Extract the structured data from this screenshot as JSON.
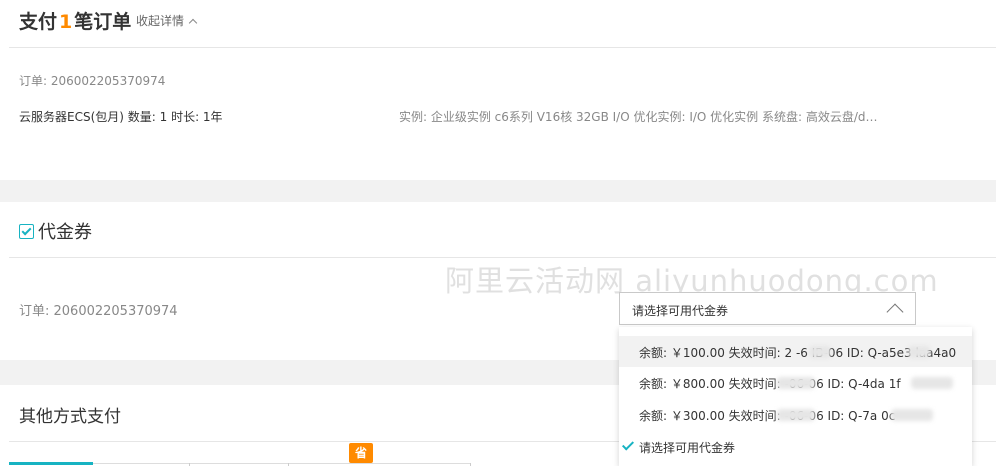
{
  "payment": {
    "title_prefix": "支付",
    "count": "1",
    "title_suffix": "笔订单",
    "collapse_label": "收起详情"
  },
  "order_summary": {
    "order_label": "订单: 206002205370974",
    "product": "云服务器ECS(包月) 数量: 1 时长: 1年",
    "spec": "实例: 企业级实例 c6系列 V16核 32GB I/O 优化实例: I/O 优化实例 系统盘: 高效云盘/dev..."
  },
  "voucher": {
    "title": "代金券",
    "checked": true,
    "order_label": "订单: 206002205370974",
    "select_placeholder": "请选择可用代金券",
    "options": [
      {
        "text": "余额: ￥100.00 失效时间: 2   -6 IB-06 ID: Q-a5e3   laa4a0"
      },
      {
        "text": "余额: ￥800.00 失效时间:        -06-06 ID: Q-4da         1f"
      },
      {
        "text": "余额: ￥300.00 失效时间:        -06-06 ID: Q-7a          0c"
      },
      {
        "text": "请选择可用代金券",
        "selected": true
      }
    ]
  },
  "watermark": "阿里云活动网 aliyunhuodong.com",
  "other_payment": {
    "title": "其他方式支付",
    "badge": "省"
  },
  "colors": {
    "accent": "#17b3c2",
    "orange": "#ff8a00"
  }
}
